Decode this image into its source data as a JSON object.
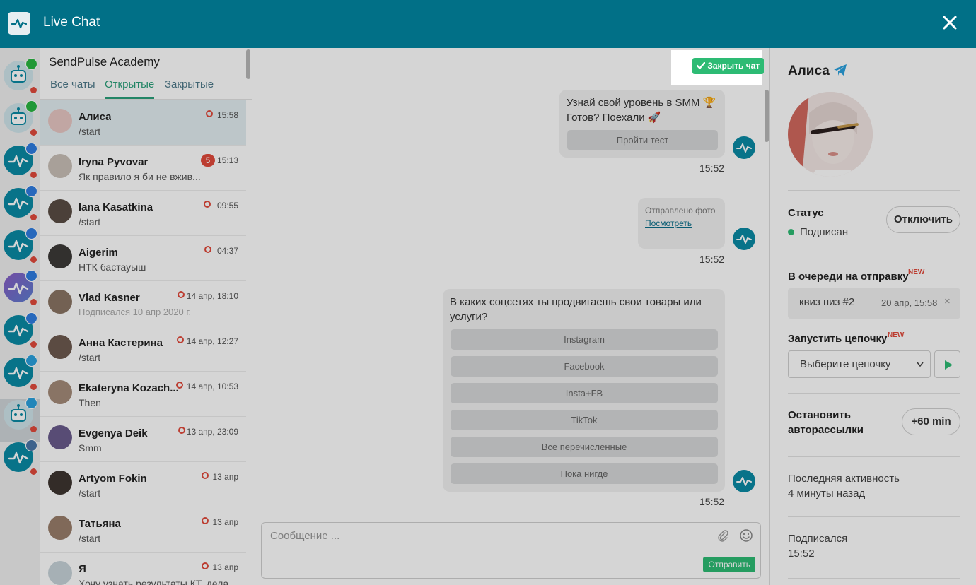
{
  "app": {
    "title": "Live Chat"
  },
  "chat_list": {
    "title": "SendPulse Academy",
    "tabs": [
      {
        "label": "Все чаты"
      },
      {
        "label": "Открытые"
      },
      {
        "label": "Закрытые"
      }
    ],
    "chats": [
      {
        "name": "Алиса",
        "message": "/start",
        "time": "15:58"
      },
      {
        "name": "Iryna Pyvovar",
        "message": "Як правило я би не вжив...",
        "time": "15:13",
        "badge": "5"
      },
      {
        "name": "Iana Kasatkina",
        "message": "/start",
        "time": "09:55"
      },
      {
        "name": "Aigerim",
        "message": "НТК бастауыш",
        "time": "04:37"
      },
      {
        "name": "Vlad Kasner",
        "message": "Подписался 10 апр 2020 г.",
        "time": "14 апр, 18:10"
      },
      {
        "name": "Анна Кастерина",
        "message": "/start",
        "time": "14 апр, 12:27"
      },
      {
        "name": "Ekateryna Kozach...",
        "message": "Then",
        "time": "14 апр, 10:53"
      },
      {
        "name": "Evgenya Deik",
        "message": "Smm",
        "time": "13 апр, 23:09"
      },
      {
        "name": "Artyom Fokin",
        "message": "/start",
        "time": "13 апр"
      },
      {
        "name": "Татьяна",
        "message": "/start",
        "time": "13 апр"
      },
      {
        "name": "Я",
        "message": "Хочу узнать результаты КТ, дела...",
        "time": "13 апр"
      }
    ]
  },
  "conversation": {
    "close_chat_label": "Закрыть чат",
    "msg1": {
      "line1": "Узнай свой уровень в SMM 🏆",
      "line2": "Готов? Поехали 🚀",
      "button": "Пройти тест",
      "time": "15:52"
    },
    "msg2": {
      "caption": "Отправлено фото",
      "link": "Посмотреть",
      "time": "15:52"
    },
    "msg3": {
      "text": "В каких соцсетях ты продвигаешь свои товары или услуги?",
      "buttons": [
        "Instagram",
        "Facebook",
        "Insta+FB",
        "TikTok",
        "Все перечисленные",
        "Пока нигде"
      ],
      "time": "15:52"
    },
    "composer": {
      "placeholder": "Сообщение ...",
      "send_label": "Отправить"
    }
  },
  "profile": {
    "name": "Алиса",
    "status_label": "Статус",
    "status_value": "Подписан",
    "unsubscribe_label": "Отключить",
    "queue_label": "В очереди на отправку",
    "new_badge": "NEW",
    "queue_item": {
      "name": "квиз пиз #2",
      "date": "20 апр, 15:58"
    },
    "chain_label": "Запустить цепочку",
    "chain_select": "Выберите цепочку",
    "stop_label_1": "Остановить",
    "stop_label_2": "авторассылки",
    "stop_button": "+60 min",
    "activity_label": "Последняя активность",
    "activity_value": "4 минуты назад",
    "subscribed_label": "Подписался",
    "subscribed_value": "15:52"
  },
  "colors": {
    "header": "#017087",
    "accent_green": "#2dbb74",
    "tab_active": "#2aa07a",
    "offline": "#e14a3b"
  }
}
